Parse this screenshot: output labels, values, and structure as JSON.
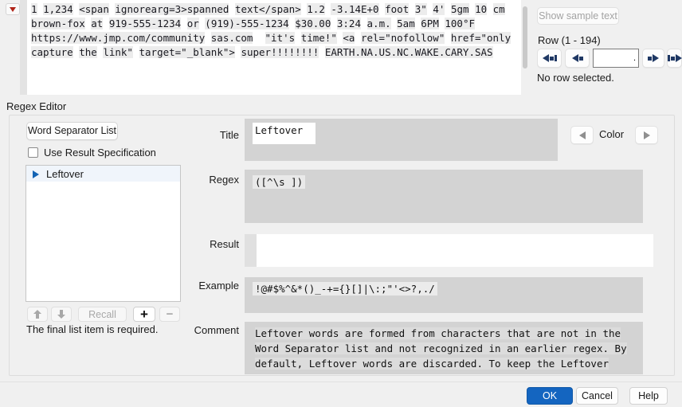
{
  "sample_panel": {
    "lines": [
      "1 1,234 <span ignorearg=3>spanned text</span> 1.2 -3.14E+0 foot 3\" 4' 5gm 10 cm",
      "brown-fox at 919-555-1234 or (919)-555-1234 $30.00 3:24 a.m. 5am 6PM 100°F",
      "https://www.jmp.com/community sas.com  \"it's time!\" <a rel=\"nofollow\" href=\"only",
      "capture the link\" target=\"_blank\"> super!!!!!!!! EARTH.NA.US.NC.WAKE.CARY.SAS"
    ]
  },
  "right_panel": {
    "show_sample_button": "Show sample text",
    "row_range_label": "Row (1 - 194)",
    "row_input_value": ".",
    "status": "No row selected."
  },
  "editor": {
    "section_title": "Regex Editor",
    "word_separator_button": "Word Separator List",
    "use_result_checkbox_label": "Use Result Specification",
    "list_items": [
      {
        "label": "Leftover"
      }
    ],
    "recall_button": "Recall",
    "plus_button": "+",
    "minus_button": "−",
    "list_note": "The final list item is required.",
    "color_label": "Color",
    "fields": {
      "title": {
        "label": "Title",
        "value": "Leftover"
      },
      "regex": {
        "label": "Regex",
        "value": "([^\\s ])"
      },
      "result": {
        "label": "Result",
        "value": ""
      },
      "example": {
        "label": "Example",
        "value": "!@#$%^&*()_-+={}[]|\\:;\"'<>?,./"
      },
      "comment": {
        "label": "Comment",
        "value": "Leftover words are formed from characters that are not in the\nWord Separator list and not recognized in an earlier regex. By\ndefault, Leftover words are discarded. To keep the Leftover"
      }
    }
  },
  "footer": {
    "ok": "OK",
    "cancel": "Cancel",
    "help": "Help"
  },
  "colors": {
    "accent": "#1465c0",
    "arrow_navy": "#1f3864",
    "red_triangle": "#b02418"
  }
}
